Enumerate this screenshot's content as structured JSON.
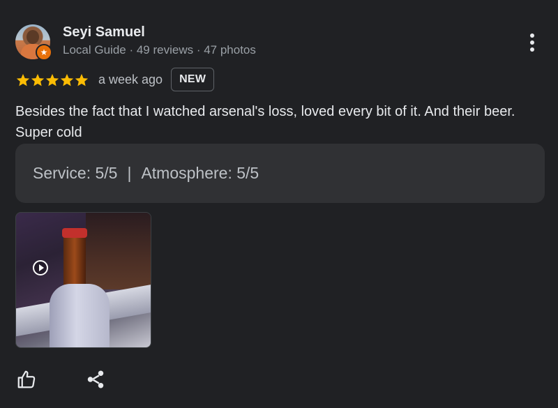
{
  "reviewer": {
    "name": "Seyi Samuel",
    "meta": "Local Guide · 49 reviews · 47 photos",
    "badge_icon": "local-guide-star"
  },
  "review": {
    "rating": 5,
    "rating_max": 5,
    "time": "a week ago",
    "new_label": "NEW",
    "text": "Besides the fact that I watched arsenal's loss, loved every bit of it. And their beer. Super cold",
    "attributes": {
      "service": "Service: 5/5",
      "separator": "|",
      "atmosphere": "Atmosphere: 5/5"
    },
    "photo": {
      "icon": "video-play-icon"
    }
  },
  "actions": {
    "like_icon": "thumbs-up-icon",
    "share_icon": "share-icon",
    "menu_icon": "more-vert-icon"
  },
  "colors": {
    "background": "#202124",
    "star": "#fbbc04",
    "attribute_panel": "#303134",
    "guide_badge": "#e8710a"
  }
}
